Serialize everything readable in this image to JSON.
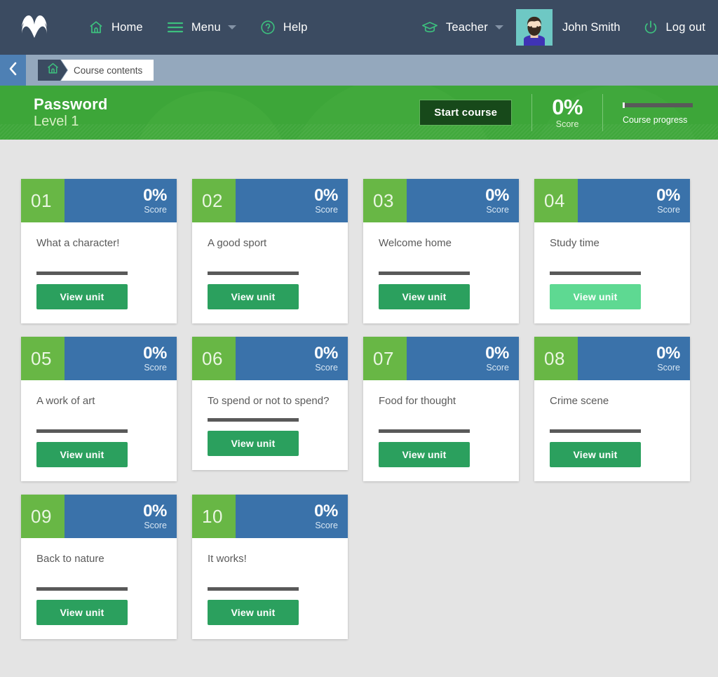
{
  "topnav": {
    "logo_icon": "mobymax-logo-icon",
    "items": [
      {
        "label": "Home",
        "icon": "home-icon"
      },
      {
        "label": "Menu",
        "icon": "hamburger-icon",
        "caret": true
      },
      {
        "label": "Help",
        "icon": "question-circle-icon"
      }
    ],
    "role": {
      "label": "Teacher",
      "icon": "graduation-cap-icon",
      "caret": true
    },
    "avatar_icon": "user-avatar",
    "username": "John Smith",
    "logout": {
      "label": "Log out",
      "icon": "power-icon"
    },
    "bg_color": "#3b4b61"
  },
  "breadcrumb": {
    "back_icon": "chevron-left-icon",
    "home_icon": "home-icon",
    "current": "Course contents",
    "bar_color": "#94a8bd"
  },
  "banner": {
    "course_name": "Password",
    "level": "Level 1",
    "start_button": "Start course",
    "score_value": "0%",
    "score_label": "Score",
    "progress_label": "Course progress",
    "progress_percent": 0,
    "bg_color": "#3da639"
  },
  "units": [
    {
      "number": "01",
      "title": "What a character!",
      "score": "0%",
      "score_label": "Score",
      "button": "View unit",
      "button_state": "normal",
      "progress_percent": 0
    },
    {
      "number": "02",
      "title": "A good sport",
      "score": "0%",
      "score_label": "Score",
      "button": "View unit",
      "button_state": "normal",
      "progress_percent": 0
    },
    {
      "number": "03",
      "title": "Welcome home",
      "score": "0%",
      "score_label": "Score",
      "button": "View unit",
      "button_state": "normal",
      "progress_percent": 0
    },
    {
      "number": "04",
      "title": "Study time",
      "score": "0%",
      "score_label": "Score",
      "button": "View unit",
      "button_state": "hover",
      "progress_percent": 0
    },
    {
      "number": "05",
      "title": "A work of art",
      "score": "0%",
      "score_label": "Score",
      "button": "View unit",
      "button_state": "normal",
      "progress_percent": 0
    },
    {
      "number": "06",
      "title": "To spend or not to spend?",
      "score": "0%",
      "score_label": "Score",
      "button": "View unit",
      "button_state": "normal",
      "progress_percent": 0
    },
    {
      "number": "07",
      "title": "Food for thought",
      "score": "0%",
      "score_label": "Score",
      "button": "View unit",
      "button_state": "normal",
      "progress_percent": 0
    },
    {
      "number": "08",
      "title": "Crime scene",
      "score": "0%",
      "score_label": "Score",
      "button": "View unit",
      "button_state": "normal",
      "progress_percent": 0
    },
    {
      "number": "09",
      "title": "Back to nature",
      "score": "0%",
      "score_label": "Score",
      "button": "View unit",
      "button_state": "normal",
      "progress_percent": 0
    },
    {
      "number": "10",
      "title": "It works!",
      "score": "0%",
      "score_label": "Score",
      "button": "View unit",
      "button_state": "normal",
      "progress_percent": 0
    }
  ],
  "colors": {
    "unit_number_bg": "#68b745",
    "unit_score_bg": "#3a72aa",
    "button_green": "#2ba05e",
    "button_green_hover": "#5ed992",
    "page_bg": "#e4e4e4"
  }
}
